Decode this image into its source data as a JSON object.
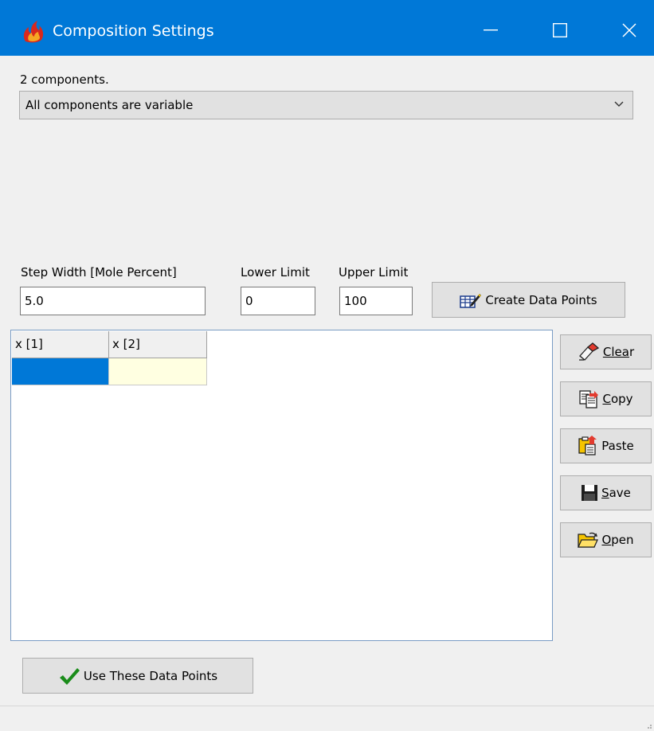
{
  "window": {
    "title": "Composition Settings",
    "minimize_icon": "minimize-icon",
    "maximize_icon": "maximize-icon",
    "close_icon": "close-icon",
    "title_bar_color": "#0078d7"
  },
  "components_label": "2 components.",
  "variability_select": {
    "value": "All components are variable"
  },
  "step_width": {
    "label": "Step Width [Mole Percent]",
    "value": "5.0"
  },
  "lower_limit": {
    "label": "Lower Limit",
    "value": "0"
  },
  "upper_limit": {
    "label": "Upper Limit",
    "value": "100"
  },
  "create_button": {
    "label": "Create Data Points"
  },
  "grid": {
    "columns": [
      "x [1]",
      "x [2]"
    ],
    "selected_cell_color": "#0078d7",
    "active_cell_color": "#ffffe1"
  },
  "side_buttons": {
    "clear": {
      "underlined": "Clea",
      "rest": "r"
    },
    "copy": {
      "underlined": "C",
      "rest": "opy"
    },
    "paste": {
      "label": "Paste"
    },
    "save": {
      "underlined": "S",
      "rest": "ave"
    },
    "open": {
      "underlined": "O",
      "rest": "pen"
    }
  },
  "use_button": {
    "label": "Use These Data Points"
  }
}
